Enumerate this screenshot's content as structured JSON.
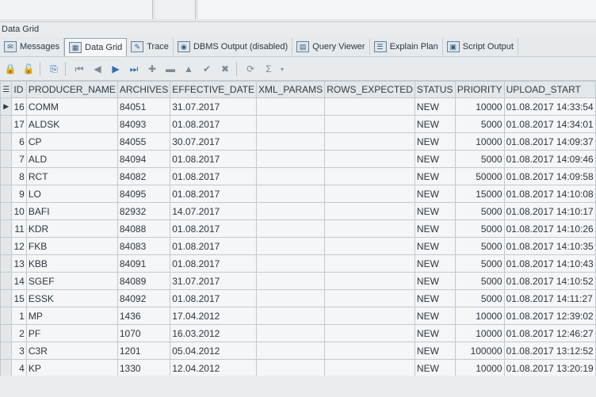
{
  "panel_title": "Data Grid",
  "tabs": [
    {
      "label": "Messages",
      "icon": "messages-icon"
    },
    {
      "label": "Data Grid",
      "icon": "grid-icon"
    },
    {
      "label": "Trace",
      "icon": "trace-icon"
    },
    {
      "label": "DBMS Output (disabled)",
      "icon": "dbms-output-icon"
    },
    {
      "label": "Query Viewer",
      "icon": "query-viewer-icon"
    },
    {
      "label": "Explain Plan",
      "icon": "explain-plan-icon"
    },
    {
      "label": "Script Output",
      "icon": "script-output-icon"
    }
  ],
  "active_tab": "Data Grid",
  "toolbar_glyphs": {
    "first": "⏮",
    "prev": "◀",
    "next": "▶",
    "last": "⏭",
    "insert": "✚",
    "delete": "▬",
    "post": "▲",
    "commit": "✔",
    "cancel": "✖",
    "sum": "Σ"
  },
  "columns": [
    "ID",
    "PRODUCER_NAME",
    "ARCHIVES",
    "EFFECTIVE_DATE",
    "XML_PARAMS",
    "ROWS_EXPECTED",
    "STATUS",
    "PRIORITY",
    "UPLOAD_START"
  ],
  "rows": [
    {
      "id": "16",
      "producer": "COMM",
      "archives": "84051",
      "date": "31.07.2017",
      "xml": "",
      "rows_expected": "",
      "status": "NEW",
      "priority": "10000",
      "upload": "01.08.2017 14:33:54"
    },
    {
      "id": "17",
      "producer": "ALDSK",
      "archives": "84093",
      "date": "01.08.2017",
      "xml": "",
      "rows_expected": "",
      "status": "NEW",
      "priority": "5000",
      "upload": "01.08.2017 14:34:01"
    },
    {
      "id": "6",
      "producer": "CP",
      "archives": "84055",
      "date": "30.07.2017",
      "xml": "",
      "rows_expected": "",
      "status": "NEW",
      "priority": "10000",
      "upload": "01.08.2017 14:09:37"
    },
    {
      "id": "7",
      "producer": "ALD",
      "archives": "84094",
      "date": "01.08.2017",
      "xml": "",
      "rows_expected": "",
      "status": "NEW",
      "priority": "5000",
      "upload": "01.08.2017 14:09:46"
    },
    {
      "id": "8",
      "producer": "RCT",
      "archives": "84082",
      "date": "01.08.2017",
      "xml": "",
      "rows_expected": "",
      "status": "NEW",
      "priority": "50000",
      "upload": "01.08.2017 14:09:58"
    },
    {
      "id": "9",
      "producer": "LO",
      "archives": "84095",
      "date": "01.08.2017",
      "xml": "",
      "rows_expected": "",
      "status": "NEW",
      "priority": "15000",
      "upload": "01.08.2017 14:10:08"
    },
    {
      "id": "10",
      "producer": "BAFI",
      "archives": "82932",
      "date": "14.07.2017",
      "xml": "",
      "rows_expected": "",
      "status": "NEW",
      "priority": "5000",
      "upload": "01.08.2017 14:10:17"
    },
    {
      "id": "11",
      "producer": "KDR",
      "archives": "84088",
      "date": "01.08.2017",
      "xml": "",
      "rows_expected": "",
      "status": "NEW",
      "priority": "5000",
      "upload": "01.08.2017 14:10:26"
    },
    {
      "id": "12",
      "producer": "FKB",
      "archives": "84083",
      "date": "01.08.2017",
      "xml": "",
      "rows_expected": "",
      "status": "NEW",
      "priority": "5000",
      "upload": "01.08.2017 14:10:35"
    },
    {
      "id": "13",
      "producer": "KBB",
      "archives": "84091",
      "date": "01.08.2017",
      "xml": "",
      "rows_expected": "",
      "status": "NEW",
      "priority": "5000",
      "upload": "01.08.2017 14:10:43"
    },
    {
      "id": "14",
      "producer": "SGEF",
      "archives": "84089",
      "date": "31.07.2017",
      "xml": "",
      "rows_expected": "",
      "status": "NEW",
      "priority": "5000",
      "upload": "01.08.2017 14:10:52"
    },
    {
      "id": "15",
      "producer": "ESSK",
      "archives": "84092",
      "date": "01.08.2017",
      "xml": "",
      "rows_expected": "",
      "status": "NEW",
      "priority": "5000",
      "upload": "01.08.2017 14:11:27"
    },
    {
      "id": "1",
      "producer": "MP",
      "archives": "1436",
      "date": "17.04.2012",
      "xml": "",
      "rows_expected": "",
      "status": "NEW",
      "priority": "10000",
      "upload": "01.08.2017 12:39:02"
    },
    {
      "id": "2",
      "producer": "PF",
      "archives": "1070",
      "date": "16.03.2012",
      "xml": "",
      "rows_expected": "",
      "status": "NEW",
      "priority": "10000",
      "upload": "01.08.2017 12:46:27"
    },
    {
      "id": "3",
      "producer": "C3R",
      "archives": "1201",
      "date": "05.04.2012",
      "xml": "",
      "rows_expected": "",
      "status": "NEW",
      "priority": "100000",
      "upload": "01.08.2017 13:12:52"
    },
    {
      "id": "4",
      "producer": "KP",
      "archives": "1330",
      "date": "12.04.2012",
      "xml": "",
      "rows_expected": "",
      "status": "NEW",
      "priority": "10000",
      "upload": "01.08.2017 13:20:19"
    }
  ],
  "current_row_marker": "▶"
}
